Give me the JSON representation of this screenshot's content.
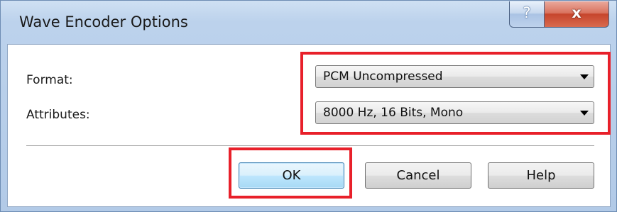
{
  "dialog": {
    "title": "Wave Encoder Options",
    "help_icon": "?",
    "close_icon": "x"
  },
  "form": {
    "format_label": "Format:",
    "format_value": "PCM Uncompressed",
    "attributes_label": "Attributes:",
    "attributes_value": "8000 Hz, 16 Bits, Mono"
  },
  "buttons": {
    "ok": "OK",
    "cancel": "Cancel",
    "help": "Help"
  },
  "colors": {
    "highlight": "#e8202a",
    "titlebar": "#bcd2ec",
    "close_button": "#c6452c"
  }
}
